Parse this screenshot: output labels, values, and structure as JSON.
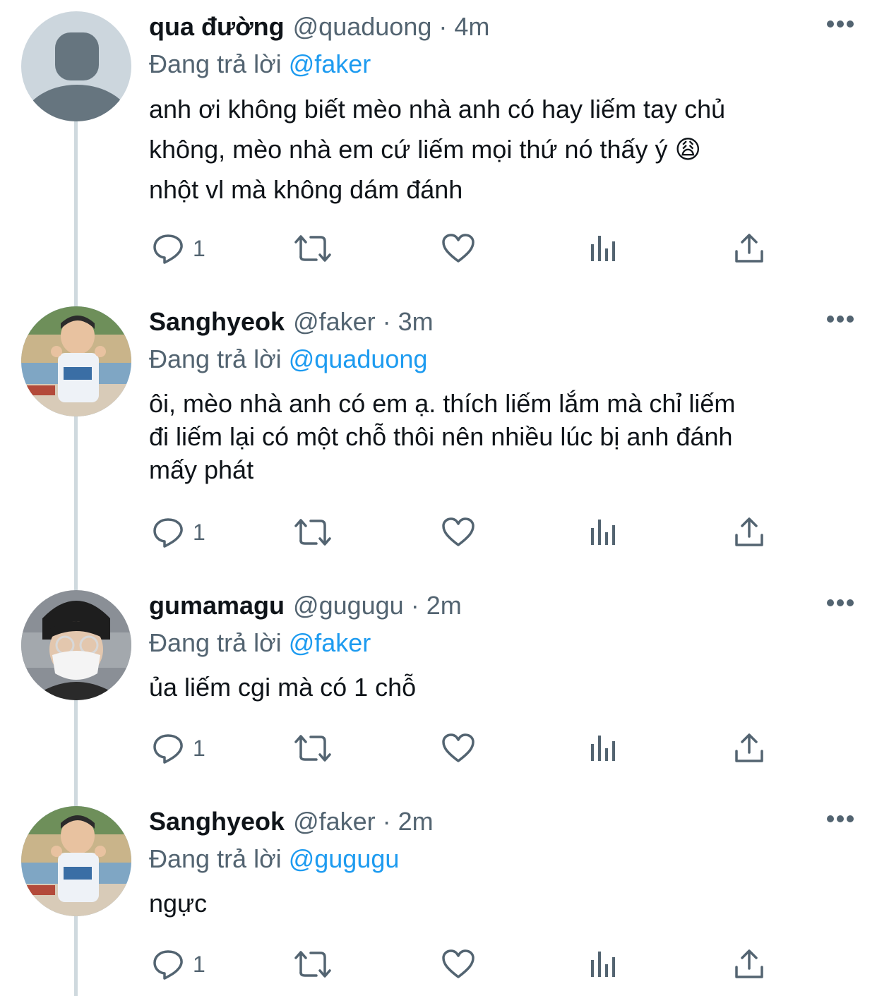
{
  "colors": {
    "accent": "#1d9bf0",
    "secondary_text": "#536471",
    "primary_text": "#0f1419",
    "thread_line": "#cfd9de"
  },
  "tweets": [
    {
      "display_name": "qua đường",
      "handle": "@quaduong",
      "separator": "·",
      "time": "4m",
      "reply_prefix": "Đang trả lời",
      "reply_to": "@faker",
      "text": "anh ơi không biết mèo nhà anh có hay liếm tay chủ\nkhông, mèo nhà em cứ liếm mọi thứ nó thấy ý 😩\nnhột vl mà không dám đánh",
      "reply_count": "1",
      "avatar": "default-avatar-icon"
    },
    {
      "display_name": "Sanghyeok",
      "handle": "@faker",
      "separator": "·",
      "time": "3m",
      "reply_prefix": "Đang trả lời",
      "reply_to": "@quaduong",
      "text": "ôi, mèo nhà anh có em ạ. thích liếm lắm mà chỉ liếm\nđi liếm lại có một chỗ thôi nên nhiều lúc bị anh đánh\nmấy phát",
      "reply_count": "1",
      "avatar": "child-photo-avatar"
    },
    {
      "display_name": "gumamagu",
      "handle": "@gugugu",
      "separator": "·",
      "time": "2m",
      "reply_prefix": "Đang trả lời",
      "reply_to": "@faker",
      "text": "ủa liếm cgi mà có 1 chỗ",
      "reply_count": "1",
      "avatar": "masked-person-avatar"
    },
    {
      "display_name": "Sanghyeok",
      "handle": "@faker",
      "separator": "·",
      "time": "2m",
      "reply_prefix": "Đang trả lời",
      "reply_to": "@gugugu",
      "text": "ngực",
      "reply_count": "1",
      "avatar": "child-photo-avatar"
    }
  ]
}
